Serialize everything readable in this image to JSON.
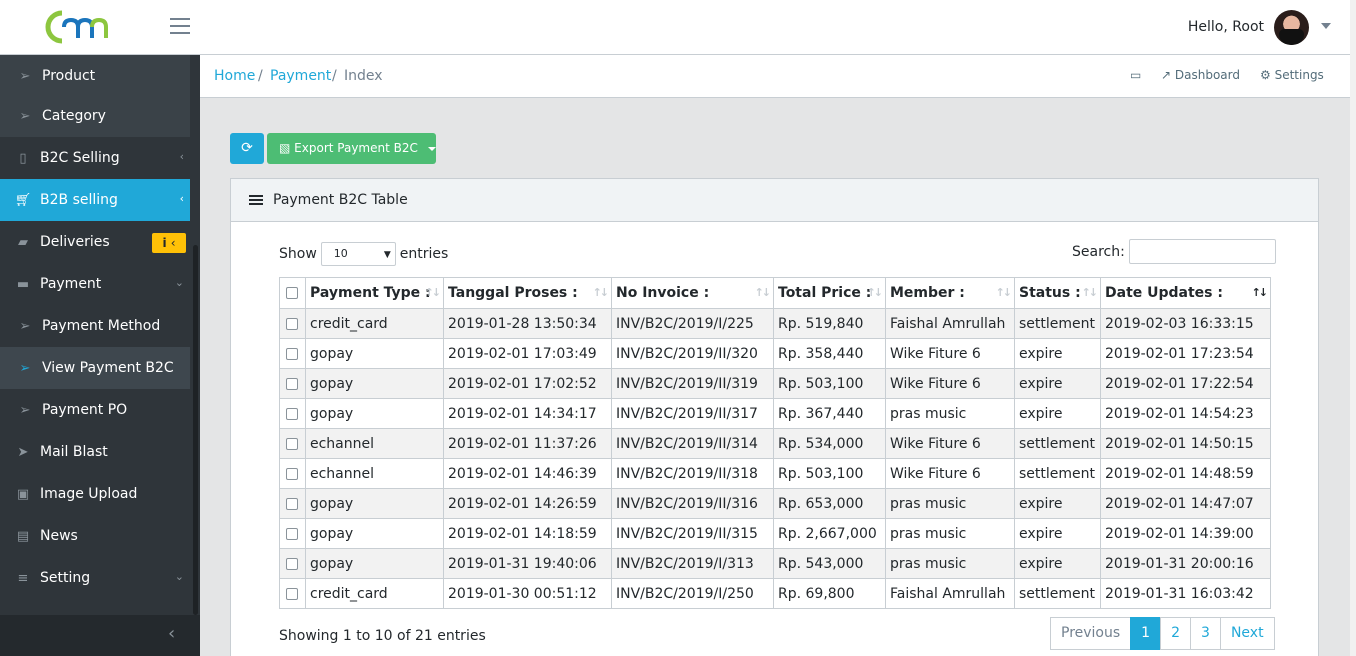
{
  "header": {
    "greeting": "Hello, Root"
  },
  "sidebar": {
    "items": [
      {
        "label": "Product",
        "icon": "paper-plane-icon"
      },
      {
        "label": "Category",
        "icon": "paper-plane-icon"
      },
      {
        "label": "B2C Selling",
        "icon": "mobile-icon"
      },
      {
        "label": "B2B selling",
        "icon": "cart-icon"
      },
      {
        "label": "Deliveries",
        "icon": "truck-icon",
        "badge": "i"
      },
      {
        "label": "Payment",
        "icon": "credit-card-icon"
      },
      {
        "label": "Payment Method",
        "icon": "paper-plane-icon"
      },
      {
        "label": "View Payment B2C",
        "icon": "paper-plane-icon"
      },
      {
        "label": "Payment PO",
        "icon": "paper-plane-icon"
      },
      {
        "label": "Mail Blast",
        "icon": "send-icon"
      },
      {
        "label": "Image Upload",
        "icon": "image-icon"
      },
      {
        "label": "News",
        "icon": "newspaper-icon"
      },
      {
        "label": "Setting",
        "icon": "bars-icon"
      }
    ]
  },
  "breadcrumb": {
    "home": "Home",
    "sep": "/",
    "payment": "Payment",
    "current": "Index",
    "dashboard": "Dashboard",
    "settings": "Settings"
  },
  "toolbar": {
    "export_label": "Export Payment B2C"
  },
  "card": {
    "title": "Payment B2C Table"
  },
  "table_controls": {
    "show": "Show",
    "entries": "entries",
    "length_value": "10",
    "search_label": "Search:"
  },
  "table": {
    "columns": [
      "Payment Type :",
      "Tanggal Proses :",
      "No Invoice :",
      "Total Price :",
      "Member :",
      "Status :",
      "Date Updates :"
    ],
    "rows": [
      [
        "credit_card",
        "2019-01-28 13:50:34",
        "INV/B2C/2019/I/225",
        "Rp. 519,840",
        "Faishal Amrullah",
        "settlement",
        "2019-02-03 16:33:15"
      ],
      [
        "gopay",
        "2019-02-01 17:03:49",
        "INV/B2C/2019/II/320",
        "Rp. 358,440",
        "Wike Fiture 6",
        "expire",
        "2019-02-01 17:23:54"
      ],
      [
        "gopay",
        "2019-02-01 17:02:52",
        "INV/B2C/2019/II/319",
        "Rp. 503,100",
        "Wike Fiture 6",
        "expire",
        "2019-02-01 17:22:54"
      ],
      [
        "gopay",
        "2019-02-01 14:34:17",
        "INV/B2C/2019/II/317",
        "Rp. 367,440",
        "pras music",
        "expire",
        "2019-02-01 14:54:23"
      ],
      [
        "echannel",
        "2019-02-01 11:37:26",
        "INV/B2C/2019/II/314",
        "Rp. 534,000",
        "Wike Fiture 6",
        "settlement",
        "2019-02-01 14:50:15"
      ],
      [
        "echannel",
        "2019-02-01 14:46:39",
        "INV/B2C/2019/II/318",
        "Rp. 503,100",
        "Wike Fiture 6",
        "settlement",
        "2019-02-01 14:48:59"
      ],
      [
        "gopay",
        "2019-02-01 14:26:59",
        "INV/B2C/2019/II/316",
        "Rp. 653,000",
        "pras music",
        "expire",
        "2019-02-01 14:47:07"
      ],
      [
        "gopay",
        "2019-02-01 14:18:59",
        "INV/B2C/2019/II/315",
        "Rp. 2,667,000",
        "pras music",
        "expire",
        "2019-02-01 14:39:00"
      ],
      [
        "gopay",
        "2019-01-31 19:40:06",
        "INV/B2C/2019/I/313",
        "Rp. 543,000",
        "pras music",
        "expire",
        "2019-01-31 20:00:16"
      ],
      [
        "credit_card",
        "2019-01-30 00:51:12",
        "INV/B2C/2019/I/250",
        "Rp. 69,800",
        "Faishal Amrullah",
        "settlement",
        "2019-01-31 16:03:42"
      ]
    ]
  },
  "footer": {
    "info": "Showing 1 to 10 of 21 entries",
    "prev": "Previous",
    "pages": [
      "1",
      "2",
      "3"
    ],
    "next": "Next"
  },
  "colors": {
    "primary": "#20a8d8",
    "success": "#4dbd74",
    "warning": "#ffc107",
    "sidebar": "#2f353a"
  }
}
